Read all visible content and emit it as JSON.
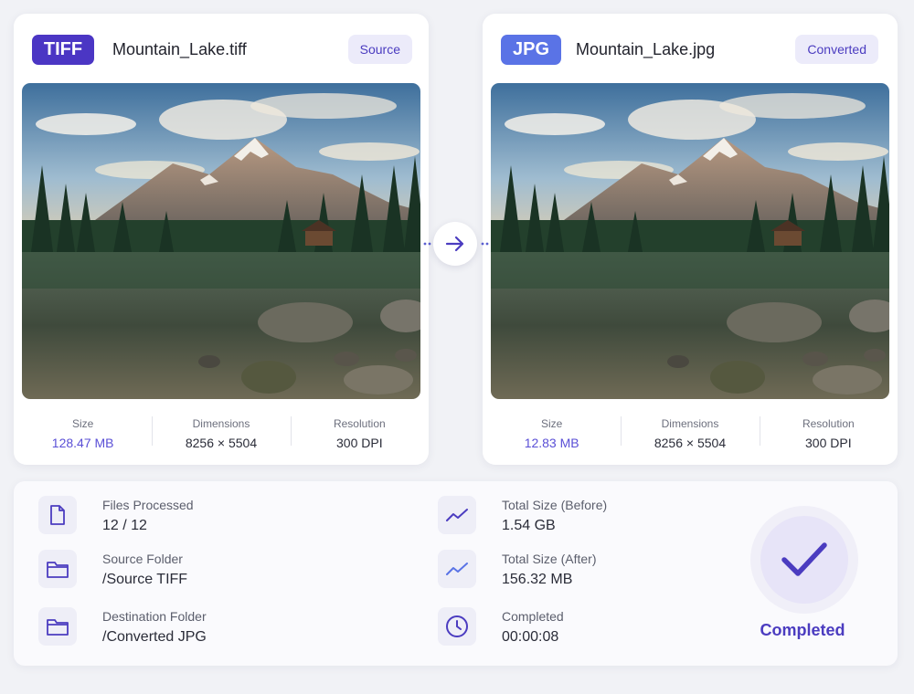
{
  "source": {
    "format": "TIFF",
    "file_name": "Mountain_Lake.tiff",
    "tag": "Source",
    "stats": [
      {
        "label": "Size",
        "value": "128.47 MB"
      },
      {
        "label": "Dimensions",
        "value": "8256 × 5504"
      },
      {
        "label": "Resolution",
        "value": "300 DPI"
      }
    ]
  },
  "converted": {
    "format": "JPG",
    "file_name": "Mountain_Lake.jpg",
    "tag": "Converted",
    "stats": [
      {
        "label": "Size",
        "value": "12.83 MB"
      },
      {
        "label": "Dimensions",
        "value": "8256 × 5504"
      },
      {
        "label": "Resolution",
        "value": "300 DPI"
      }
    ]
  },
  "summary": {
    "files_processed": {
      "label": "Files Processed",
      "value": "12 / 12",
      "icon": "file-icon"
    },
    "source_folder": {
      "label": "Source Folder",
      "value": "/Source TIFF",
      "icon": "folder-icon"
    },
    "destination_folder": {
      "label": "Destination Folder",
      "value": "/Converted JPG",
      "icon": "folder-icon"
    },
    "total_before": {
      "label": "Total Size (Before)",
      "value": "1.54 GB",
      "icon": "trend-icon"
    },
    "total_after": {
      "label": "Total Size (After)",
      "value": "156.32 MB",
      "icon": "trend-icon"
    },
    "completed_time": {
      "label": "Completed",
      "value": "00:00:08",
      "icon": "clock-icon"
    },
    "status": "Completed"
  },
  "colors": {
    "accent": "#4b3cc0",
    "tiff_badge": "#4b36c4",
    "jpg_badge": "#5a73e6",
    "highlight_value": "#5a4fd6"
  }
}
